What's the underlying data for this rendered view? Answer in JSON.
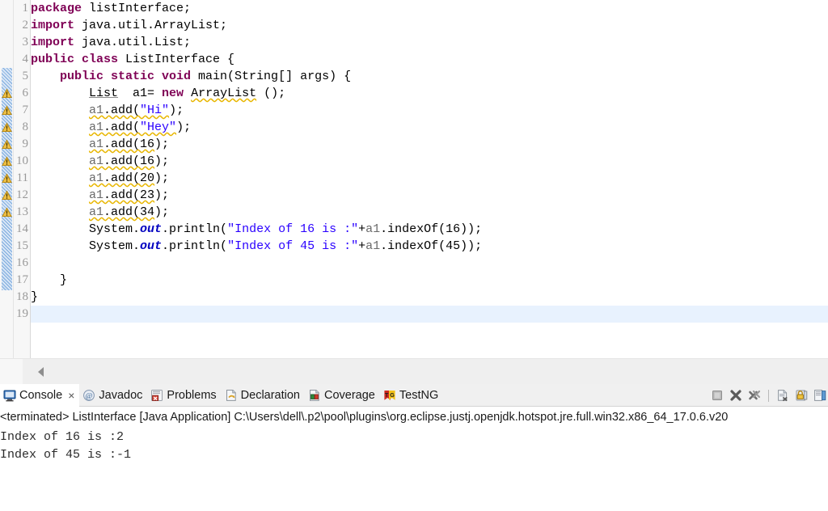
{
  "editor": {
    "name": "java-source-editor",
    "caret_line": 19,
    "gutter": {
      "line_numbers": [
        1,
        2,
        3,
        4,
        5,
        6,
        7,
        8,
        9,
        10,
        11,
        12,
        13,
        14,
        15,
        16,
        17,
        18,
        19
      ],
      "fold_markers_on_lines": [
        2,
        5
      ],
      "warning_marker_lines": [
        6,
        7,
        8,
        9,
        10,
        11,
        12,
        13
      ],
      "warning_icon": "warning-triangle-icon"
    },
    "lines": [
      {
        "n": 1,
        "segments": [
          {
            "t": "package ",
            "c": "kw"
          },
          {
            "t": "listInterface;",
            "c": "plain"
          }
        ]
      },
      {
        "n": 2,
        "segments": [
          {
            "t": "import ",
            "c": "kw"
          },
          {
            "t": "java.util.ArrayList;",
            "c": "plain"
          }
        ]
      },
      {
        "n": 3,
        "segments": [
          {
            "t": "import ",
            "c": "kw"
          },
          {
            "t": "java.util.List;",
            "c": "plain"
          }
        ]
      },
      {
        "n": 4,
        "segments": [
          {
            "t": "public class ",
            "c": "kw"
          },
          {
            "t": "ListInterface {",
            "c": "plain"
          }
        ]
      },
      {
        "n": 5,
        "segments": [
          {
            "t": "    ",
            "c": "plain"
          },
          {
            "t": "public static void ",
            "c": "kw"
          },
          {
            "t": "main(String[] args) {",
            "c": "plain"
          }
        ]
      },
      {
        "n": 6,
        "segments": [
          {
            "t": "        ",
            "c": "plain"
          },
          {
            "t": "List",
            "c": "typ"
          },
          {
            "t": "  a1= ",
            "c": "plain"
          },
          {
            "t": "new ",
            "c": "kw"
          },
          {
            "t": "ArrayList",
            "c": "typ sq"
          },
          {
            "t": " ();",
            "c": "plain"
          }
        ]
      },
      {
        "n": 7,
        "segments": [
          {
            "t": "        ",
            "c": "plain"
          },
          {
            "t": "a1",
            "c": "fld sq"
          },
          {
            "t": ".add(",
            "c": "plain sq"
          },
          {
            "t": "\"Hi\"",
            "c": "str sq"
          },
          {
            "t": ");",
            "c": "plain"
          }
        ]
      },
      {
        "n": 8,
        "segments": [
          {
            "t": "        ",
            "c": "plain"
          },
          {
            "t": "a1",
            "c": "fld sq"
          },
          {
            "t": ".add(",
            "c": "plain sq"
          },
          {
            "t": "\"Hey\"",
            "c": "str sq"
          },
          {
            "t": ");",
            "c": "plain"
          }
        ]
      },
      {
        "n": 9,
        "segments": [
          {
            "t": "        ",
            "c": "plain"
          },
          {
            "t": "a1",
            "c": "fld sq"
          },
          {
            "t": ".add(16",
            "c": "plain sq"
          },
          {
            "t": ");",
            "c": "plain"
          }
        ]
      },
      {
        "n": 10,
        "segments": [
          {
            "t": "        ",
            "c": "plain"
          },
          {
            "t": "a1",
            "c": "fld sq"
          },
          {
            "t": ".add(16",
            "c": "plain sq"
          },
          {
            "t": ");",
            "c": "plain"
          }
        ]
      },
      {
        "n": 11,
        "segments": [
          {
            "t": "        ",
            "c": "plain"
          },
          {
            "t": "a1",
            "c": "fld sq"
          },
          {
            "t": ".add(20",
            "c": "plain sq"
          },
          {
            "t": ");",
            "c": "plain"
          }
        ]
      },
      {
        "n": 12,
        "segments": [
          {
            "t": "        ",
            "c": "plain"
          },
          {
            "t": "a1",
            "c": "fld sq"
          },
          {
            "t": ".add(23",
            "c": "plain sq"
          },
          {
            "t": ");",
            "c": "plain"
          }
        ]
      },
      {
        "n": 13,
        "segments": [
          {
            "t": "        ",
            "c": "plain"
          },
          {
            "t": "a1",
            "c": "fld sq"
          },
          {
            "t": ".add(34",
            "c": "plain sq"
          },
          {
            "t": ");",
            "c": "plain"
          }
        ]
      },
      {
        "n": 14,
        "segments": [
          {
            "t": "        ",
            "c": "plain"
          },
          {
            "t": "System.",
            "c": "plain"
          },
          {
            "t": "out",
            "c": "sout"
          },
          {
            "t": ".println(",
            "c": "plain"
          },
          {
            "t": "\"Index of 16 is :\"",
            "c": "str"
          },
          {
            "t": "+",
            "c": "plain"
          },
          {
            "t": "a1",
            "c": "fld"
          },
          {
            "t": ".indexOf(16));",
            "c": "plain"
          }
        ]
      },
      {
        "n": 15,
        "segments": [
          {
            "t": "        ",
            "c": "plain"
          },
          {
            "t": "System.",
            "c": "plain"
          },
          {
            "t": "out",
            "c": "sout"
          },
          {
            "t": ".println(",
            "c": "plain"
          },
          {
            "t": "\"Index of 45 is :\"",
            "c": "str"
          },
          {
            "t": "+",
            "c": "plain"
          },
          {
            "t": "a1",
            "c": "fld"
          },
          {
            "t": ".indexOf(45));",
            "c": "plain"
          }
        ]
      },
      {
        "n": 16,
        "segments": [
          {
            "t": "",
            "c": "plain"
          }
        ]
      },
      {
        "n": 17,
        "segments": [
          {
            "t": "    }",
            "c": "plain"
          }
        ]
      },
      {
        "n": 18,
        "segments": [
          {
            "t": "}",
            "c": "plain"
          }
        ]
      },
      {
        "n": 19,
        "segments": [
          {
            "t": "",
            "c": "plain"
          }
        ]
      }
    ]
  },
  "console_panel": {
    "tabs": [
      {
        "label": "Console",
        "icon": "console-monitor-icon",
        "active": true,
        "closable": true,
        "close_glyph": "×"
      },
      {
        "label": "Javadoc",
        "icon": "javadoc-at-icon",
        "active": false,
        "closable": false
      },
      {
        "label": "Problems",
        "icon": "problems-icon",
        "active": false,
        "closable": false
      },
      {
        "label": "Declaration",
        "icon": "declaration-icon",
        "active": false,
        "closable": false
      },
      {
        "label": "Coverage",
        "icon": "coverage-icon",
        "active": false,
        "closable": false
      },
      {
        "label": "TestNG",
        "icon": "testng-icon",
        "active": false,
        "closable": false
      }
    ],
    "toolbar": [
      {
        "name": "terminate-button",
        "icon": "stop-square-icon"
      },
      {
        "name": "remove-launch-button",
        "icon": "x-thick-icon"
      },
      {
        "name": "remove-all-launches-button",
        "icon": "double-x-icon"
      },
      {
        "name": "separator",
        "icon": "separator"
      },
      {
        "name": "clear-console-button",
        "icon": "clear-document-icon"
      },
      {
        "name": "scroll-lock-button",
        "icon": "lock-icon"
      },
      {
        "name": "pin-console-button",
        "icon": "pin-console-icon"
      }
    ],
    "header": "<terminated> ListInterface [Java Application] C:\\Users\\dell\\.p2\\pool\\plugins\\org.eclipse.justj.openjdk.hotspot.jre.full.win32.x86_64_17.0.6.v20",
    "output_lines": [
      "Index of 16 is :2",
      "Index of 45 is :-1"
    ]
  },
  "colors": {
    "keyword": "#7f0055",
    "string": "#2a00ff",
    "field": "#6a6a6a",
    "static_field": "#0000c0",
    "warning_squiggle": "#e8b600",
    "caret_line": "#e8f2fe",
    "gutter_bg": "#f7f7f7",
    "panel_bg": "#f0f0f0"
  }
}
